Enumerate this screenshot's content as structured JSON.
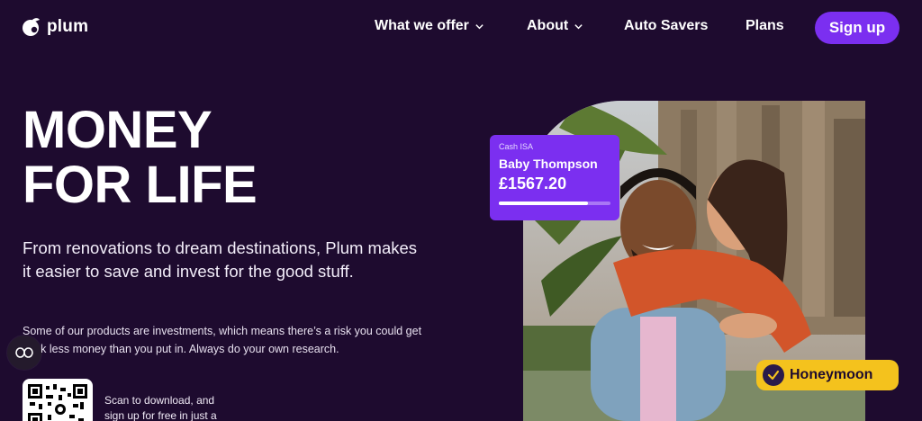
{
  "header": {
    "logo_text": "plum",
    "nav": [
      {
        "label": "What we offer",
        "has_dropdown": true
      },
      {
        "label": "About",
        "has_dropdown": true
      },
      {
        "label": "Auto Savers",
        "has_dropdown": false
      },
      {
        "label": "Plans",
        "has_dropdown": false
      }
    ],
    "signup_label": "Sign up"
  },
  "hero": {
    "title": "MONEY\nFOR LIFE",
    "subtitle": "From renovations to dream destinations, Plum makes it easier to save and invest for the good stuff.",
    "risk_warning": "Some of our products are investments, which means there’s a risk you could get back less money than you put in. Always do your own research.",
    "qr_text": "Scan to download, and sign up for free in just a"
  },
  "isa_card": {
    "label": "Cash ISA",
    "name": "Baby Thompson",
    "amount": "£1567.20",
    "progress": 0.8
  },
  "goal_badge": {
    "label": "Honeymoon"
  },
  "colors": {
    "background": "#1e0b2f",
    "accent_purple": "#7b2ff0",
    "badge_yellow": "#f4c21d"
  },
  "icons": [
    "plum-logo-icon",
    "chevron-down-icon",
    "cookie-settings-icon",
    "check-icon",
    "qr-code"
  ]
}
